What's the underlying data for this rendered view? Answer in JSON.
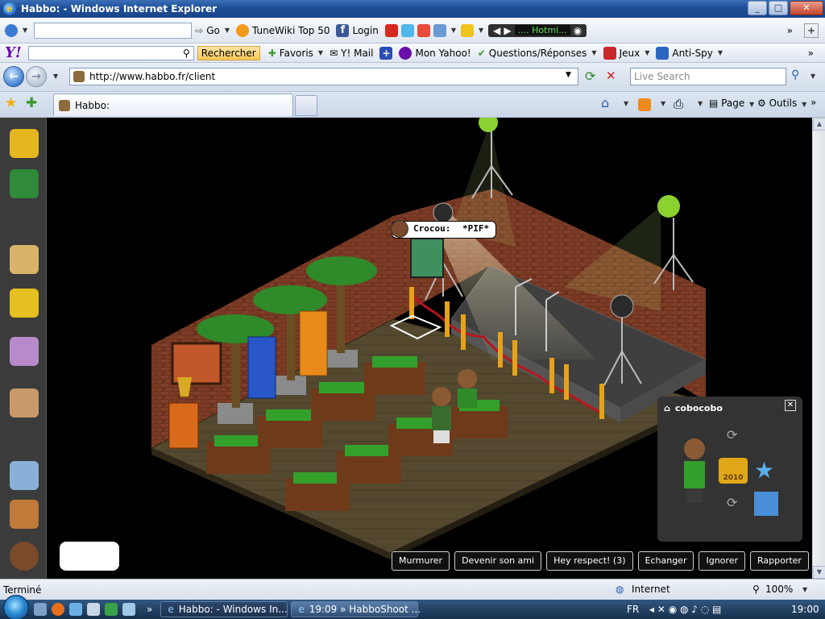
{
  "window": {
    "title": "Habbo: - Windows Internet Explorer"
  },
  "toolbar1": {
    "go_label": "Go",
    "tunewiki_label": "TuneWiki Top 50",
    "login_label": "Login",
    "hotmail_label": ".... Hotmi...",
    "add_label": "+"
  },
  "toolbar2": {
    "yahoo_logo": "Y!",
    "rechercher_label": "Rechercher",
    "favoris_label": "Favoris",
    "ymail_label": "Y! Mail",
    "monyahoo_label": "Mon Yahoo!",
    "questions_label": "Questions/Réponses",
    "jeux_label": "Jeux",
    "antispy_label": "Anti-Spy"
  },
  "navbar": {
    "back_label": "←",
    "forward_label": "→",
    "url": "http://www.habbo.fr/client",
    "search_placeholder": "Live Search"
  },
  "tabs": {
    "active_tab": "Habbo:",
    "page_label": "Page",
    "outils_label": "Outils"
  },
  "habbo": {
    "speech_name": "Crocou:",
    "speech_text": "*PIF*",
    "namecard_name": "cobocobo",
    "badge_year": "2010",
    "actions": [
      "Murmurer",
      "Devenir son ami",
      "Hey respect! (3)",
      "Echanger",
      "Ignorer",
      "Rapporter"
    ]
  },
  "statusbar": {
    "status": "Terminé",
    "zone": "Internet",
    "zoom": "100%"
  },
  "taskbar": {
    "task1": "Habbo: - Windows In...",
    "task2": "19:09 » HabboShoot ...",
    "lang": "FR",
    "clock": "19:00"
  },
  "colors": {
    "titlebar": "#1d4f96",
    "floor": "#514631",
    "wall": "#7a3a25",
    "stage": "#3e3e3e",
    "sofa": "#33a02c",
    "spotlight": "#8bd12f"
  }
}
